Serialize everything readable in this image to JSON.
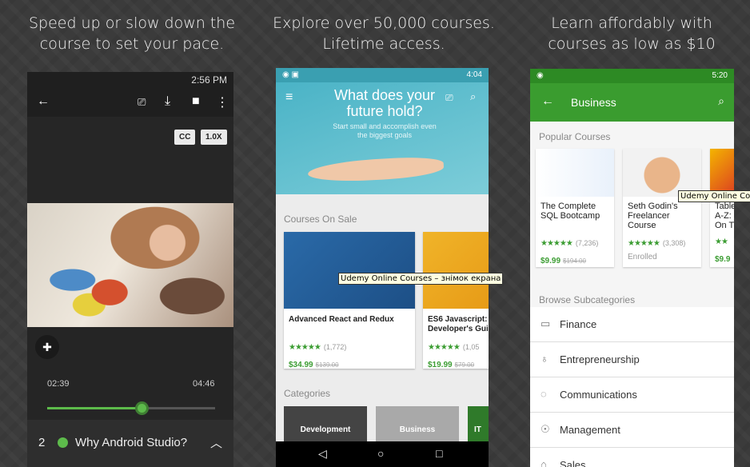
{
  "captions": {
    "left": "Speed up or slow down the course to set your pace.",
    "middle": "Explore over 50,000 courses. Lifetime access.",
    "right": "Learn affordably with courses as low as $10"
  },
  "phone1": {
    "time": "2:56 PM",
    "cc": "CC",
    "speed": "1.0X",
    "elapsed": "02:39",
    "duration": "04:46",
    "progress": 0.56,
    "lesson_number": "2",
    "lesson_title": "Why Android Studio?"
  },
  "phone2": {
    "time": "4:04",
    "hero_title": "What does your future hold?",
    "hero_sub": "Start small and accomplish even the biggest goals",
    "section_sale": "Courses On Sale",
    "cards": [
      {
        "title": "Advanced React and Redux",
        "stars": "★★★★★",
        "rating_count": "(1,772)",
        "price": "$34.99",
        "old_price": "$139.00"
      },
      {
        "title": "ES6 Javascript: T Developer's Guid",
        "stars": "★★★★★",
        "rating_count": "(1,05",
        "price": "$19.99",
        "old_price": "$79.00"
      }
    ],
    "section_categories": "Categories",
    "categories": [
      "Development",
      "Business",
      "IT"
    ]
  },
  "phone3": {
    "time": "5:20",
    "title": "Business",
    "section_popular": "Popular Courses",
    "cards": [
      {
        "title": "The Complete SQL Bootcamp",
        "stars": "★★★★★",
        "rating_count": "(7,236)",
        "price": "$9.99",
        "old_price": "$194.00"
      },
      {
        "title": "Seth Godin's Freelancer Course",
        "stars": "★★★★★",
        "rating_count": "(3,308)",
        "status": "Enrolled"
      },
      {
        "title": "Table A-Z: On T",
        "stars": "★★",
        "price": "$9.9"
      }
    ],
    "section_sub": "Browse Subcategories",
    "subcategories": [
      "Finance",
      "Entrepreneurship",
      "Communications",
      "Management",
      "Sales"
    ]
  },
  "tooltips": {
    "middle": "Udemy Online Courses – знімок екрана",
    "right": "Udemy Online Courses"
  },
  "colors": {
    "udemy_green": "#3c9d33",
    "hero_teal": "#4ab3c6",
    "bar_green": "#3a9c2f"
  }
}
